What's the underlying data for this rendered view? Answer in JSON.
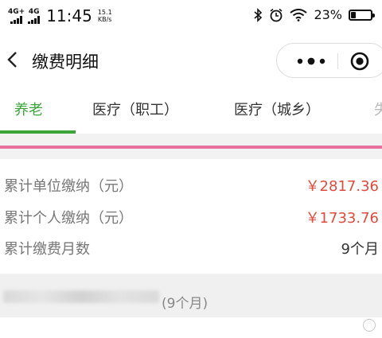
{
  "status_bar": {
    "net1_label": "4G+",
    "net2_label": "4G",
    "time": "11:45",
    "speed_value": "15.1",
    "speed_unit": "KB/s",
    "battery_pct": "23%",
    "battery_level": 0.23
  },
  "navbar": {
    "title": "缴费明细",
    "more_icon": "more-dots-icon",
    "target_icon": "target-icon"
  },
  "tabs": [
    {
      "label": "养老",
      "active": true
    },
    {
      "label": "医疗（职工）",
      "active": false
    },
    {
      "label": "医疗（城乡）",
      "active": false
    },
    {
      "label": "失",
      "active": false
    }
  ],
  "summary": {
    "rows": [
      {
        "label": "累计单位缴纳（元）",
        "value": "￥2817.36"
      },
      {
        "label": "累计个人缴纳（元）",
        "value": "￥1733.76"
      },
      {
        "label": "累计缴费月数",
        "value": "9个月"
      }
    ]
  },
  "section": {
    "suffix": "(9个月)"
  },
  "colors": {
    "accent_green": "#3aa63a",
    "amount_red": "#e04a3c",
    "divider_pink": "#e7709c"
  }
}
